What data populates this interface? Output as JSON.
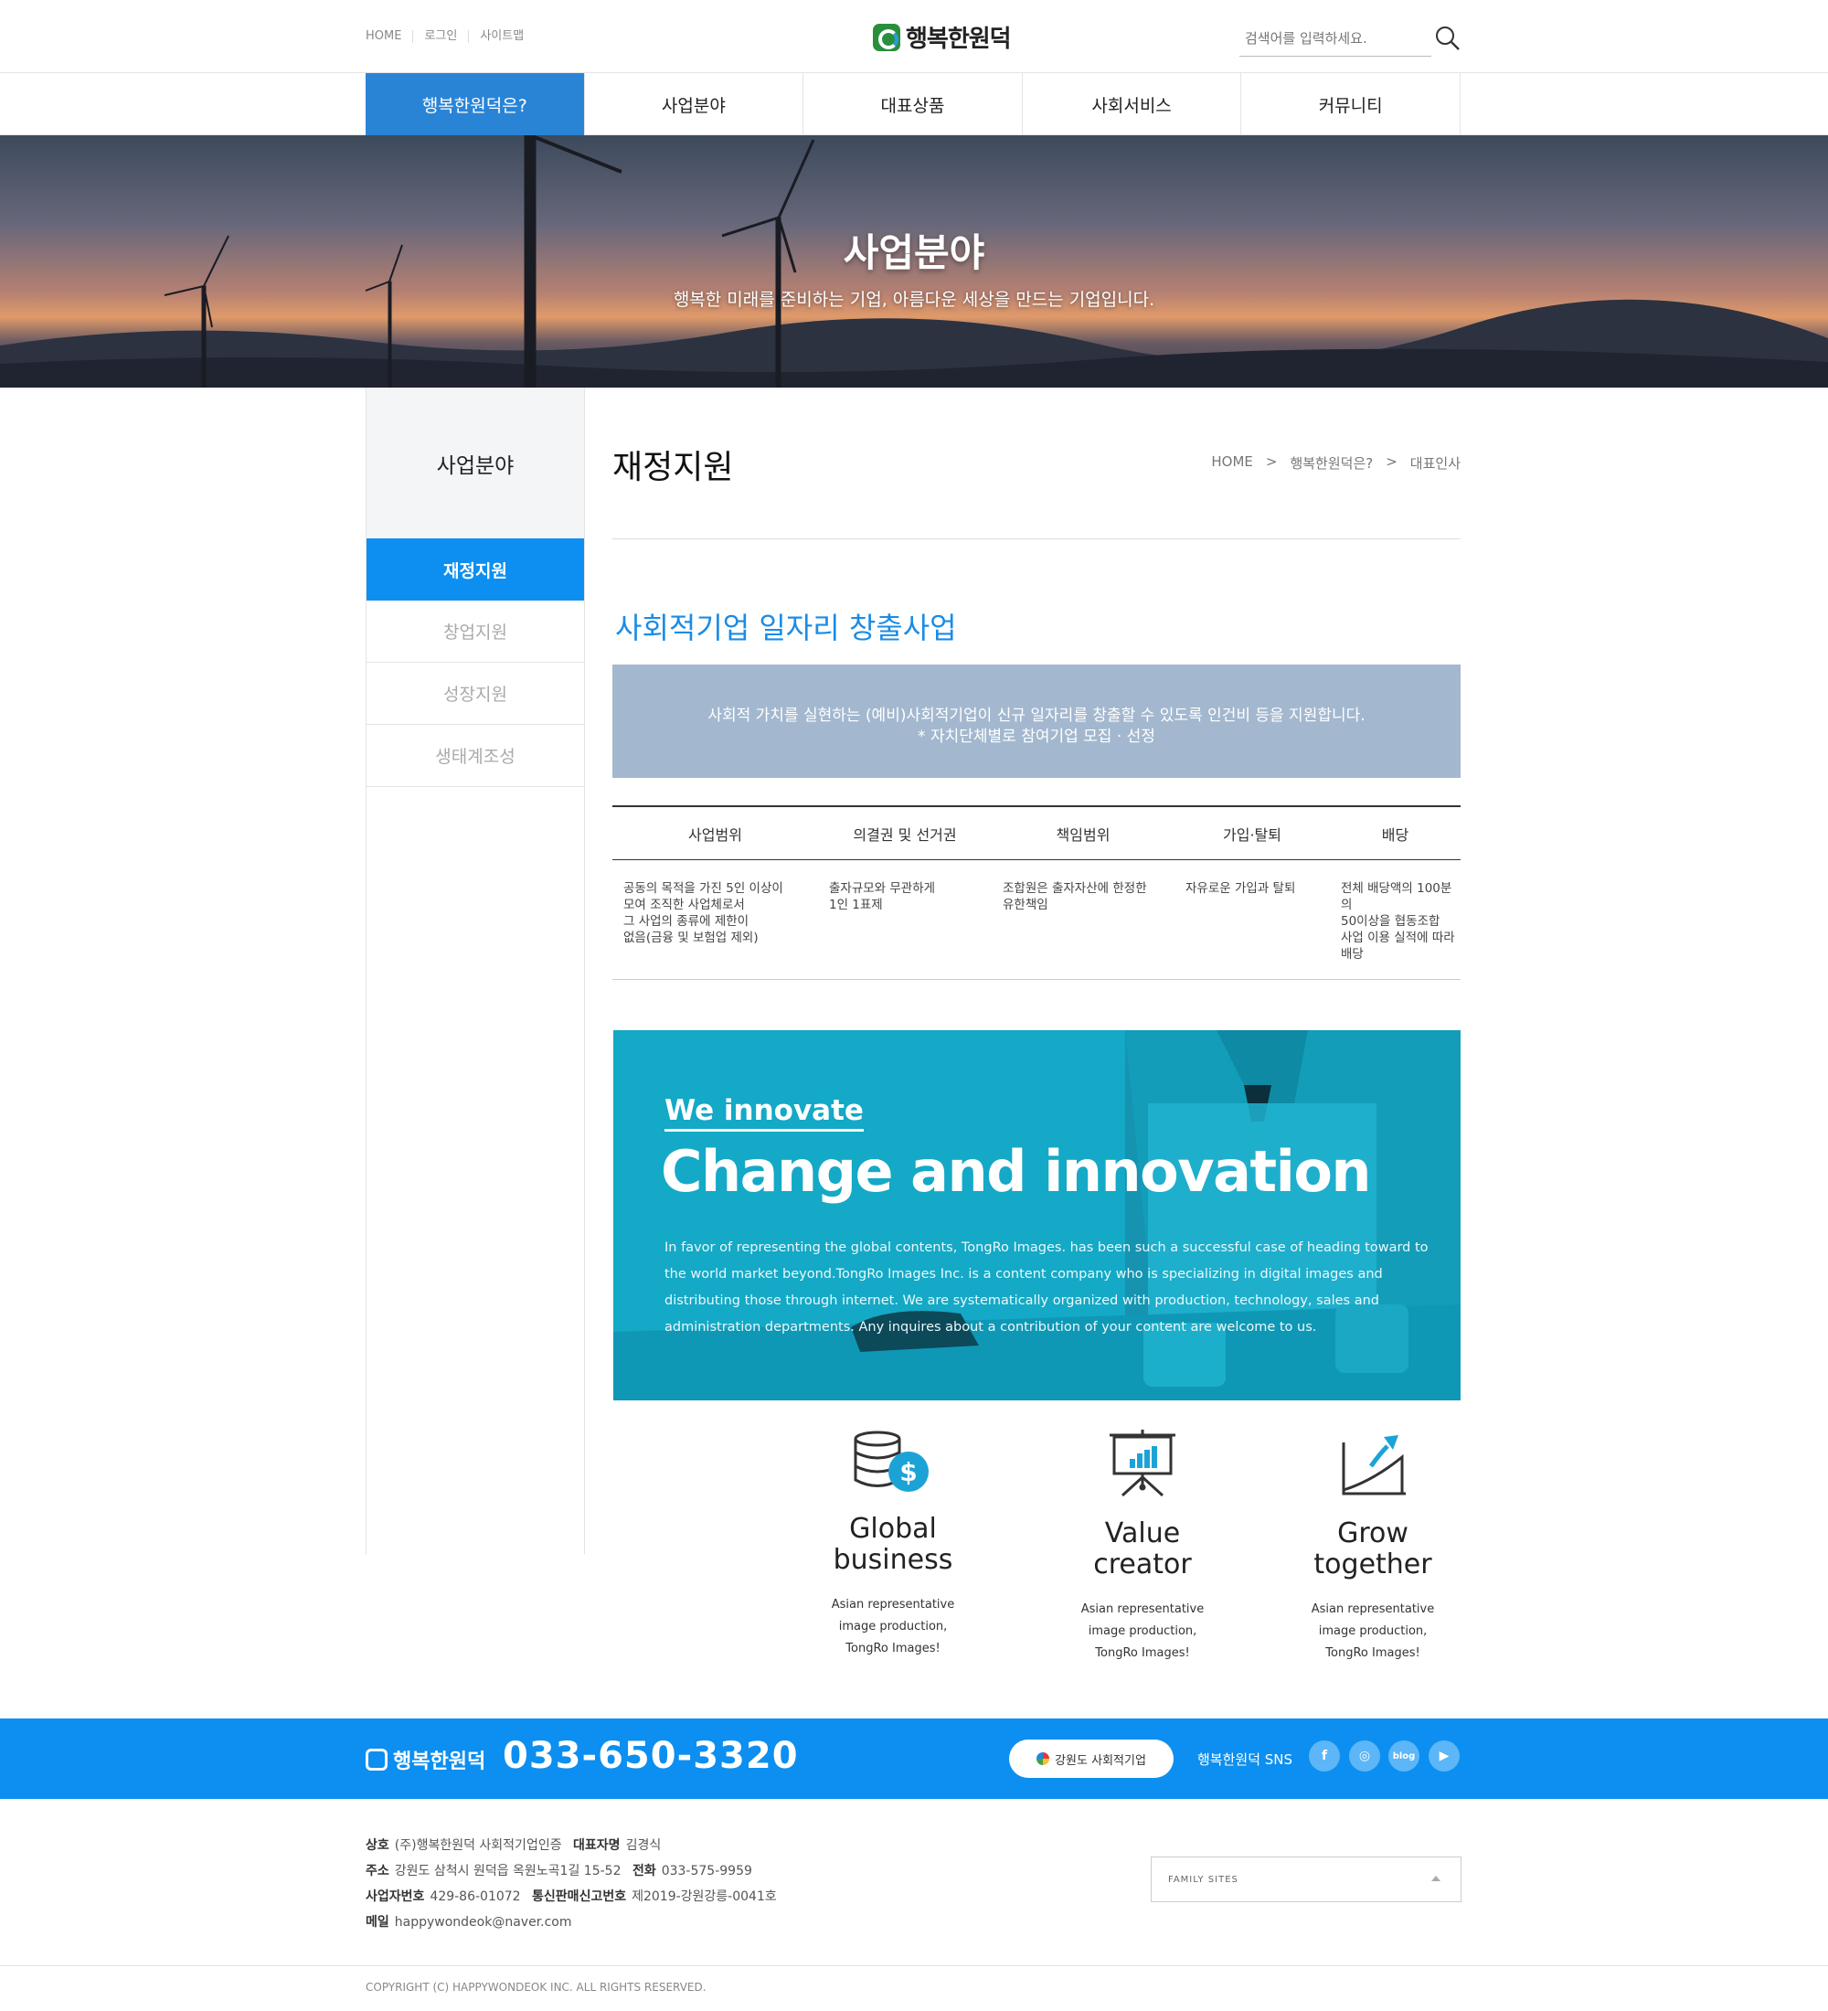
{
  "util_links": [
    "HOME",
    "로그인",
    "사이트맵"
  ],
  "logo_text": "행복한원덕",
  "search": {
    "placeholder": "검색어를 입력하세요."
  },
  "gnb": [
    "행복한원덕은?",
    "사업분야",
    "대표상품",
    "사회서비스",
    "커뮤니티"
  ],
  "hero": {
    "title": "사업분야",
    "subtitle": "행복한 미래를 준비하는 기업, 아름다운 세상을 만드는 기업입니다."
  },
  "lnb": {
    "title": "사업분야",
    "items": [
      "재정지원",
      "창업지원",
      "성장지원",
      "생태계조성"
    ]
  },
  "page_title": "재정지원",
  "breadcrumb": [
    "HOME",
    ">",
    "행복한원덕은?",
    ">",
    "대표인사"
  ],
  "section_title": "사회적기업 일자리 창출사업",
  "infobox": {
    "line1": "사회적 가치를 실현하는 (예비)사회적기업이 신규 일자리를 창출할 수 있도록 인건비 등을 지원합니다.",
    "line2": "* 자치단체별로 참여기업 모집 · 선정"
  },
  "table": {
    "headers": [
      "사업범위",
      "의결권 및 선거권",
      "책임범위",
      "가입·탈퇴",
      "배당"
    ],
    "cells": [
      [
        "공동의 목적을 가진 5인 이상이",
        "모여 조직한 사업체로서",
        "그 사업의 종류에 제한이",
        "없음(금융 및 보험업 제외)"
      ],
      [
        "출자규모와 무관하게",
        "1인 1표제"
      ],
      [
        "조합원은 출자자산에 한정한",
        "유한책임"
      ],
      [
        "자유로운 가입과 탈퇴"
      ],
      [
        "전체 배당액의 100분의",
        "50이상을 협동조합",
        "사업 이용 실적에 따라",
        "배당"
      ]
    ]
  },
  "banner": {
    "kicker": "We innovate",
    "headline": "Change and innovation",
    "body": "In favor of representing the global contents, TongRo Images. has been such a successful case of heading toward to the world market beyond.TongRo Images Inc. is a content company who is specializing in digital images and distributing those through internet. We are systematically organized with production, technology, sales and administration departments. Any inquires about a contribution of your content are welcome to us."
  },
  "features": [
    {
      "icon": "coins-dollar-icon",
      "title1": "Global",
      "title2": "business",
      "desc": [
        "Asian representative",
        "image production,",
        "TongRo Images!"
      ]
    },
    {
      "icon": "presentation-chart-icon",
      "title1": "Value",
      "title2": "creator",
      "desc": [
        "Asian representative",
        "image production,",
        "TongRo Images!"
      ]
    },
    {
      "icon": "growth-chart-icon",
      "title1": "Grow",
      "title2": "together",
      "desc": [
        "Asian representative",
        "image production,",
        "TongRo Images!"
      ]
    }
  ],
  "footer": {
    "logo_text": "행복한원덕",
    "phone": "033-650-3320",
    "badge": "강원도 사회적기업",
    "sns_label": "행복한원덕 SNS",
    "sns": [
      "f",
      "◎",
      "blog",
      "▶"
    ],
    "info": {
      "company_label": "상호",
      "company": "(주)행복한원덕 사회적기업인증",
      "ceo_label": "대표자명",
      "ceo": "김경식",
      "address_label": "주소",
      "address": "강원도 삼척시 원덕읍 옥원노곡1길 15-52",
      "tel_label": "전화",
      "tel": "033-575-9959",
      "biz_label": "사업자번호",
      "biz": "429-86-01072",
      "mail_order_label": "통신판매신고번호",
      "mail_order": "제2019-강원강릉-0041호",
      "email_label": "메일",
      "email": "happywondeok@naver.com"
    },
    "family_sites": "FAMILY SITES",
    "copyright": "COPYRIGHT (C) HAPPYWONDEOK INC. ALL RIGHTS RESERVED."
  },
  "colors": {
    "primary": "#0c8ff0",
    "gnb_active": "#2a84d6",
    "infobox": "#a3b8cf",
    "banner": "#14a9c6"
  }
}
